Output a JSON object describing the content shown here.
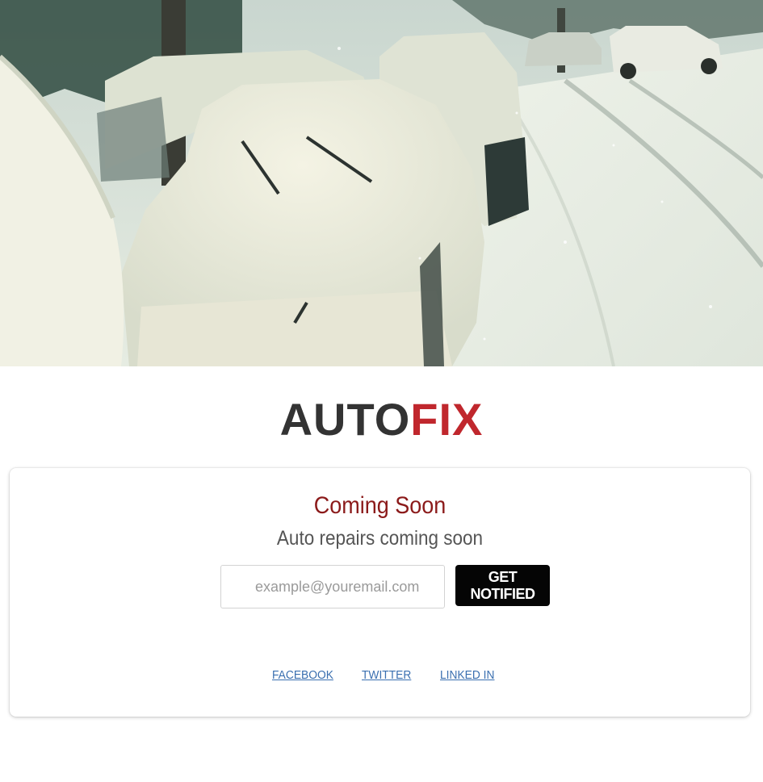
{
  "brand": {
    "logo_part1": "AUTO",
    "logo_part2": "FIX",
    "logo_color_dark": "#333333",
    "logo_color_accent": "#c0272d"
  },
  "hero": {
    "image": "snow-covered-cars-street-photo"
  },
  "signup": {
    "title": "Coming Soon",
    "subtitle": "Auto repairs coming soon",
    "email_placeholder": "example@youremail.com",
    "email_value": "",
    "button_label": "GET NOTIFIED",
    "title_color": "#8b1a1a",
    "button_color": "#050505"
  },
  "social": {
    "links": [
      "FACEBOOK",
      "TWITTER",
      "LINKED IN"
    ],
    "link_color": "#3a6fb0"
  }
}
